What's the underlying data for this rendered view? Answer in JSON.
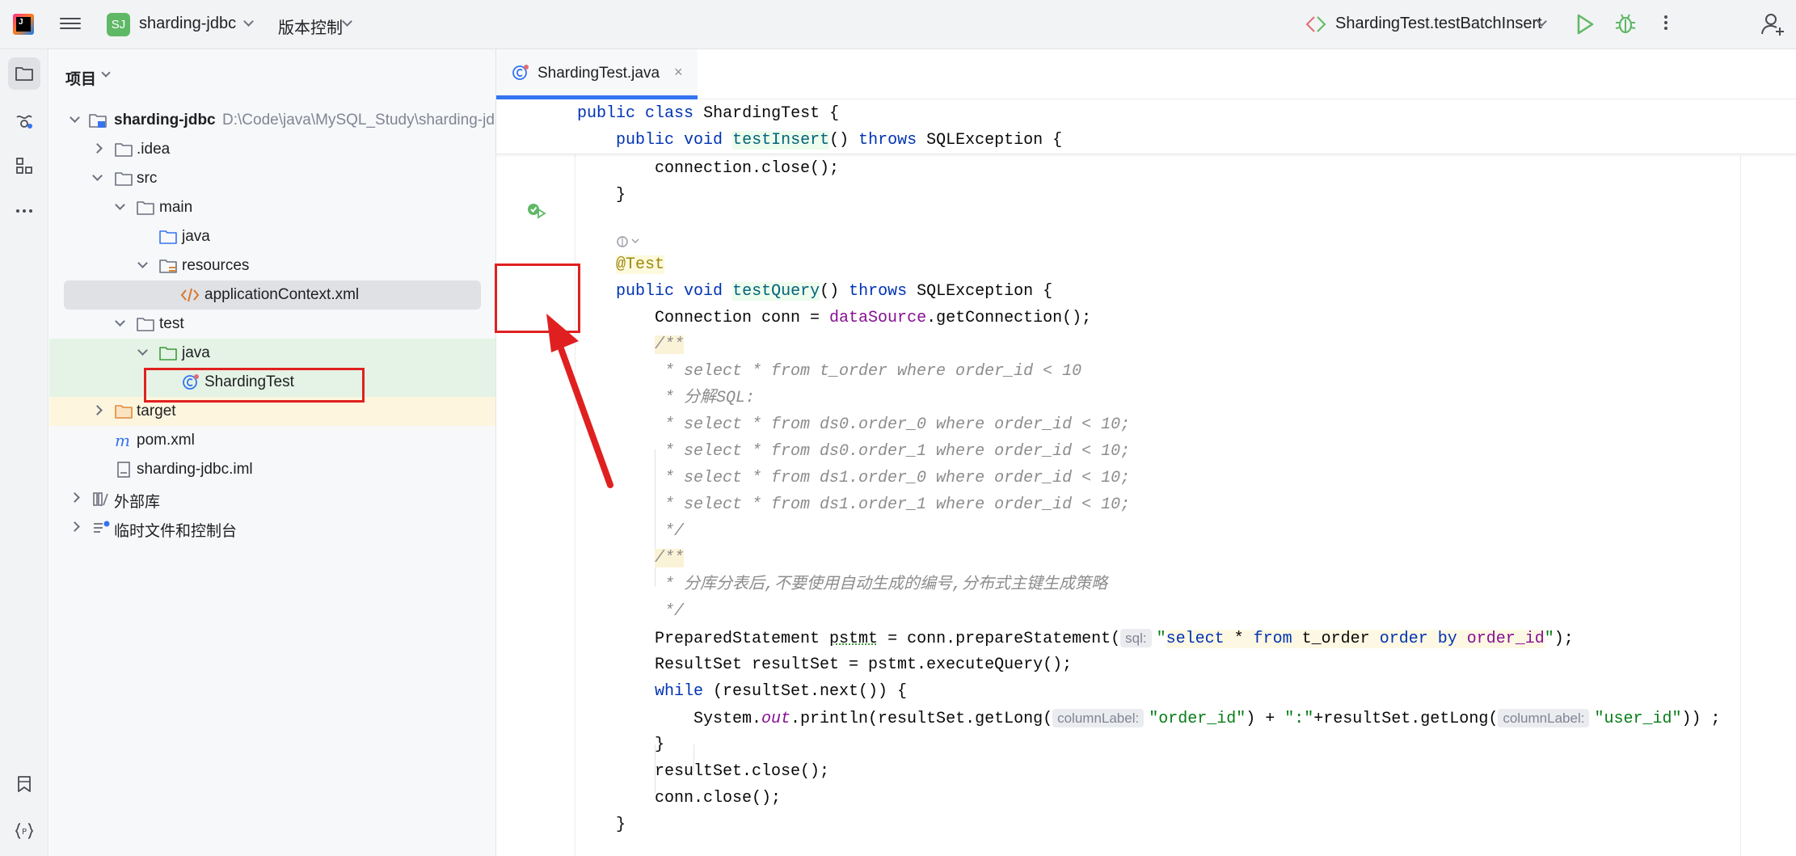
{
  "topbar": {
    "app_logo_text": "J",
    "project_badge": "SJ",
    "project_name": "sharding-jdbc",
    "vcs_label": "版本控制",
    "run_config_name": "ShardingTest.testBatchInsert",
    "icons": [
      "main-menu-icon",
      "run-config-icon",
      "run-icon",
      "debug-icon",
      "more-icon",
      "add-user-icon"
    ],
    "accent_run_color": "#5fb865"
  },
  "toolstrip": {
    "icons": [
      "folder-icon",
      "commit-icon",
      "structure-icon",
      "more-tools-icon",
      "bookmarks-icon",
      "services-icon"
    ]
  },
  "project_panel": {
    "title": "项目",
    "tree": [
      {
        "label": "sharding-jdbc",
        "path": "D:\\Code\\java\\MySQL_Study\\sharding-jd",
        "icon": "module-folder-icon",
        "expanded": true
      },
      {
        "label": ".idea",
        "icon": "folder-icon",
        "expanded": false
      },
      {
        "label": "src",
        "icon": "folder-icon",
        "expanded": true
      },
      {
        "label": "main",
        "icon": "folder-icon",
        "expanded": true
      },
      {
        "label": "java",
        "icon": "source-folder-icon"
      },
      {
        "label": "resources",
        "icon": "resources-folder-icon",
        "expanded": true
      },
      {
        "label": "applicationContext.xml",
        "icon": "xml-file-icon",
        "selected": true
      },
      {
        "label": "test",
        "icon": "folder-icon",
        "expanded": true
      },
      {
        "label": "java",
        "icon": "test-folder-icon",
        "expanded": true
      },
      {
        "label": "ShardingTest",
        "icon": "test-class-icon"
      },
      {
        "label": "target",
        "icon": "excluded-folder-icon",
        "expanded": false
      },
      {
        "label": "pom.xml",
        "icon": "maven-icon"
      },
      {
        "label": "sharding-jdbc.iml",
        "icon": "iml-file-icon"
      },
      {
        "label": "外部库",
        "icon": "library-icon",
        "expanded": false
      },
      {
        "label": "临时文件和控制台",
        "icon": "scratches-icon",
        "expanded": false
      }
    ]
  },
  "editor": {
    "tab_label": "ShardingTest.java",
    "tab_close": "×",
    "sticky": {
      "line1": {
        "kw1": "public",
        "kw2": "class",
        "name": "ShardingTest {"
      },
      "line2": {
        "kw1": "public",
        "kw2": "void",
        "fn": "testInsert",
        "mid": "() ",
        "kw3": "throws",
        "rest": " SQLException {"
      }
    },
    "code": {
      "l1": "connection.close();",
      "l2": "}",
      "l3_ann": "@Test",
      "l4": {
        "kw1": "public",
        "kw2": "void",
        "fn": "testQuery",
        "mid": "() ",
        "kw3": "throws",
        "rest": " SQLException {"
      },
      "l5": {
        "a": "Connection conn = ",
        "field": "dataSource",
        "b": ".getConnection();"
      },
      "l6": "/**",
      "l7": " * select * from t_order where order_id < 10",
      "l8": " * 分解SQL:",
      "l9": " * select * from ds0.order_0 where order_id < 10;",
      "l10": " * select * from ds0.order_1 where order_id < 10;",
      "l11": " * select * from ds1.order_0 where order_id < 10;",
      "l12": " * select * from ds1.order_1 where order_id < 10;",
      "l13": " */",
      "l14": "/**",
      "l15": " * 分库分表后,不要使用自动生成的编号,分布式主键生成策略",
      "l16": " */",
      "l17": {
        "a": "PreparedStatement ",
        "var": "pstmt",
        "b": " = conn.prepareStatement(",
        "hint": "sql:",
        "q1": "\"",
        "k1": "select",
        "s1": " * ",
        "k2": "from",
        "s2": " t_order ",
        "k3": "order by",
        "s3": " ",
        "f1": "order_id",
        "q2": "\"",
        "end": ");"
      },
      "l18": "ResultSet resultSet = pstmt.executeQuery();",
      "l19": {
        "kw": "while",
        "rest": " (resultSet.next()) {"
      },
      "l20": {
        "a": "System.",
        "out": "out",
        "b": ".println(resultSet.getLong(",
        "hint1": "columnLabel:",
        "s1": "\"order_id\"",
        "c": ") + ",
        "s2": "\":\"",
        "d": "+resultSet.getLong(",
        "hint2": "columnLabel:",
        "s3": "\"user_id\"",
        "e": ")) ;"
      },
      "l21": "}",
      "l22": "resultSet.close();",
      "l23": "conn.close();",
      "l24": "}"
    }
  }
}
